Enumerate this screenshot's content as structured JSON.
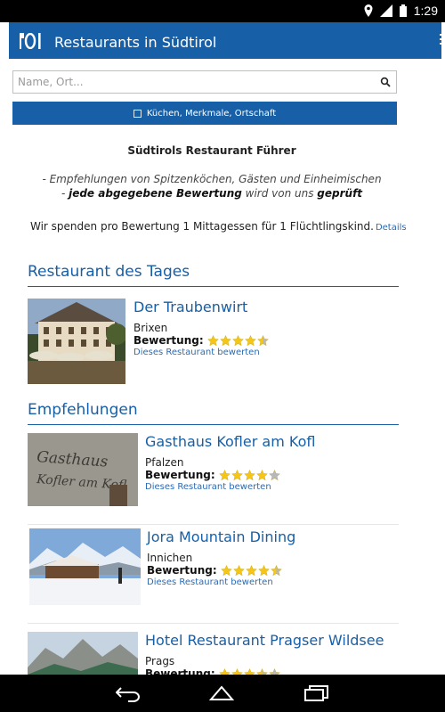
{
  "status": {
    "time": "1:29"
  },
  "appbar": {
    "title": "Restaurants in Südtirol"
  },
  "search": {
    "placeholder": "Name, Ort..."
  },
  "filter": {
    "label": "Küchen, Merkmale, Ortschaft"
  },
  "intro": {
    "title": "Südtirols Restaurant Führer",
    "line1": "- Empfehlungen von Spitzenköchen, Gästen und Einheimischen",
    "line2_prefix": "- ",
    "line2_bold1": "jede abgegebene Bewertung",
    "line2_mid": " wird von uns ",
    "line2_bold2": "geprüft",
    "donate": "Wir spenden pro Bewertung 1 Mittagessen für 1 Flüchtlingskind.",
    "details_link": "Details"
  },
  "sections": {
    "daily": "Restaurant des Tages",
    "recommendations": "Empfehlungen"
  },
  "rating_label": "Bewertung:",
  "rate_link": "Dieses Restaurant bewerten",
  "restaurants": [
    {
      "name": "Der Traubenwirt",
      "town": "Brixen",
      "rating": 4.5
    },
    {
      "name": "Gasthaus Kofler am Kofl",
      "town": "Pfalzen",
      "rating": 4
    },
    {
      "name": "Jora Mountain Dining",
      "town": "Innichen",
      "rating": 4.5
    },
    {
      "name": "Hotel Restaurant Pragser Wildsee",
      "town": "Prags",
      "rating": 3.5
    }
  ],
  "sign_text": {
    "line1": "Gasthaus",
    "line2": "Kofler am Kofl"
  },
  "colors": {
    "brand": "#175fa6",
    "star": "#f5c518",
    "star_empty": "#b8b8b8"
  }
}
